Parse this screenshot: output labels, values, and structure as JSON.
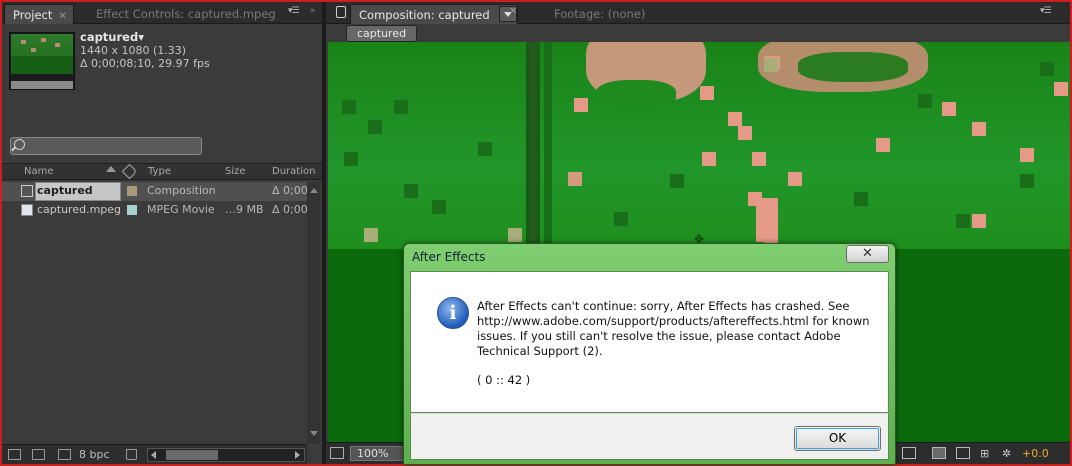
{
  "project_panel": {
    "tabs": [
      {
        "label": "Project",
        "active": true
      },
      {
        "label": "Effect Controls: captured.mpeg",
        "active": false
      }
    ],
    "selected_item": {
      "name": "captured▾",
      "resolution": "1440 x 1080 (1.33)",
      "timing": "Δ 0;00;08;10, 29.97 fps"
    },
    "search": {
      "placeholder": ""
    },
    "columns": {
      "name": "Name",
      "type": "Type",
      "size": "Size",
      "duration": "Duration"
    },
    "items": [
      {
        "name": "captured",
        "label_color": "#a89a7a",
        "type": "Composition",
        "size": "",
        "duration": "Δ 0;00",
        "icon": "composition-icon"
      },
      {
        "name": "captured.mpeg",
        "label_color": "#a8d0d0",
        "type": "MPEG Movie",
        "size": "…9 MB",
        "duration": "Δ 0;00",
        "icon": "footage-icon"
      }
    ],
    "bottom": {
      "bpc": "8 bpc"
    }
  },
  "comp_panel": {
    "tabs": [
      {
        "label": "Composition: captured",
        "active": true
      },
      {
        "label": "Footage: (none)",
        "active": false
      }
    ],
    "breadcrumb": "captured",
    "zoom": "100%",
    "exposure": "+0.0"
  },
  "dialog": {
    "title": "After Effects",
    "close": "✕",
    "message": "After Effects can't continue: sorry, After Effects has crashed. See http://www.adobe.com/support/products/aftereffects.html for known issues. If you still can't resolve the issue, please contact Adobe Technical Support (2).",
    "code": "( 0 :: 42 )",
    "ok_label": "OK",
    "icon": "info-icon"
  },
  "colors": {
    "frame_border": "#cc1f1f",
    "viewer_green": "#148a14",
    "dialog_chrome": "#6fc062",
    "exposure": "#e7b12c"
  }
}
